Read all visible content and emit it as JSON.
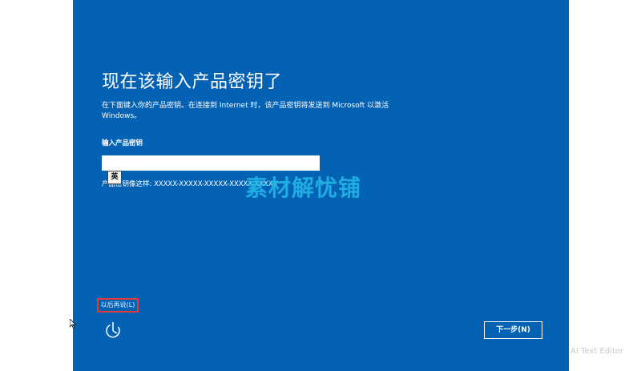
{
  "window": {
    "title": "现在该输入产品密钥了",
    "description": "在下面键入你的产品密钥。在连接到 Internet 时，该产品密钥将发送到 Microsoft 以激活 Windows。"
  },
  "key_field": {
    "label": "输入产品密钥",
    "value": "",
    "ime_indicator": "英",
    "format_hint": "产品密钥像这样: XXXXX-XXXXX-XXXXX-XXXXX-XXXXX"
  },
  "footer": {
    "skip_link": "以后再说(L)",
    "next_button": "下一步(N)",
    "accessibility_icon": "accessibility-icon"
  },
  "overlays": {
    "center_watermark": "素材解忧铺",
    "corner_watermark": "AI Text Editor"
  },
  "colors": {
    "panel_background": "#0462b5",
    "skip_highlight": "#e53935",
    "watermark": "#22b5e8"
  }
}
